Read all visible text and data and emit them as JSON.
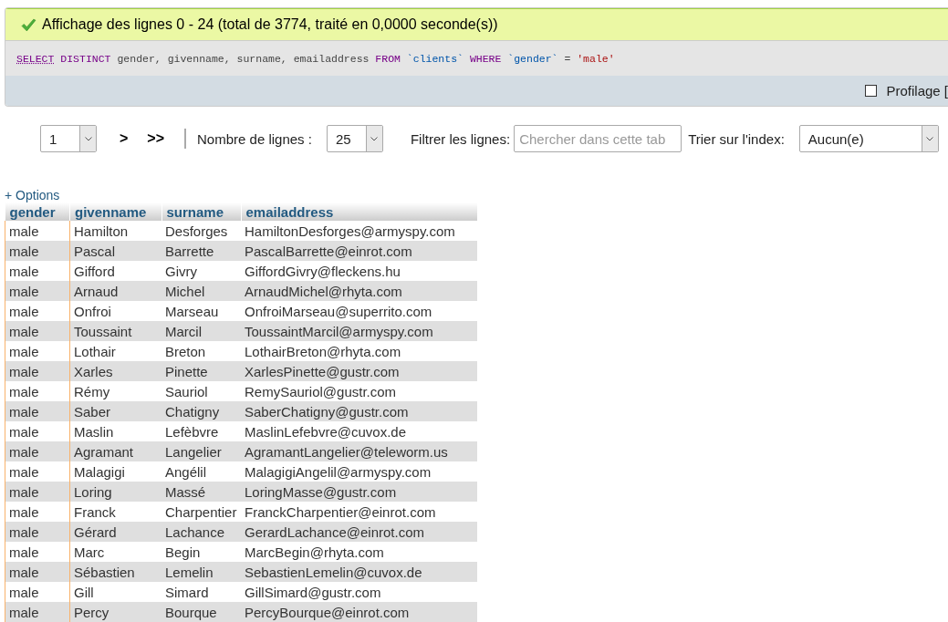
{
  "message": {
    "kind": "success",
    "text": "Affichage des lignes 0 - 24 (total de 3774, traité en 0,0000 seconde(s))"
  },
  "query": [
    {
      "kind": "keyword_link",
      "text": "SELECT"
    },
    {
      "kind": "keyword",
      "text": "DISTINCT"
    },
    {
      "kind": "plain",
      "text": "gender, givenname, surname, emailaddress"
    },
    {
      "kind": "keyword",
      "text": "FROM"
    },
    {
      "kind": "identifier",
      "text": "`clients`"
    },
    {
      "kind": "keyword",
      "text": "WHERE"
    },
    {
      "kind": "identifier",
      "text": "`gender`"
    },
    {
      "kind": "plain",
      "text": "="
    },
    {
      "kind": "string",
      "text": "'male'"
    }
  ],
  "profiling": {
    "label": "Profilage [",
    "checked": false
  },
  "navigation": {
    "page": "1",
    "next": ">",
    "last": ">>",
    "rows_label": "Nombre de lignes :",
    "rows_value": "25",
    "filter_label": "Filtrer les lignes:",
    "filter_placeholder": "Chercher dans cette tab",
    "sort_label": "Trier sur l'index:",
    "sort_value": "Aucun(e)"
  },
  "options_link": "+ Options",
  "table": {
    "columns": [
      "gender",
      "givenname",
      "surname",
      "emailaddress"
    ],
    "rows": [
      [
        "male",
        "Hamilton",
        "Desforges",
        "HamiltonDesforges@armyspy.com"
      ],
      [
        "male",
        "Pascal",
        "Barrette",
        "PascalBarrette@einrot.com"
      ],
      [
        "male",
        "Gifford",
        "Givry",
        "GiffordGivry@fleckens.hu"
      ],
      [
        "male",
        "Arnaud",
        "Michel",
        "ArnaudMichel@rhyta.com"
      ],
      [
        "male",
        "Onfroi",
        "Marseau",
        "OnfroiMarseau@superrito.com"
      ],
      [
        "male",
        "Toussaint",
        "Marcil",
        "ToussaintMarcil@armyspy.com"
      ],
      [
        "male",
        "Lothair",
        "Breton",
        "LothairBreton@rhyta.com"
      ],
      [
        "male",
        "Xarles",
        "Pinette",
        "XarlesPinette@gustr.com"
      ],
      [
        "male",
        "Rémy",
        "Sauriol",
        "RemySauriol@gustr.com"
      ],
      [
        "male",
        "Saber",
        "Chatigny",
        "SaberChatigny@gustr.com"
      ],
      [
        "male",
        "Maslin",
        "Lefèbvre",
        "MaslinLefebvre@cuvox.de"
      ],
      [
        "male",
        "Agramant",
        "Langelier",
        "AgramantLangelier@teleworm.us"
      ],
      [
        "male",
        "Malagigi",
        "Angélil",
        "MalagigiAngelil@armyspy.com"
      ],
      [
        "male",
        "Loring",
        "Massé",
        "LoringMasse@gustr.com"
      ],
      [
        "male",
        "Franck",
        "Charpentier",
        "FranckCharpentier@einrot.com"
      ],
      [
        "male",
        "Gérard",
        "Lachance",
        "GerardLachance@einrot.com"
      ],
      [
        "male",
        "Marc",
        "Begin",
        "MarcBegin@rhyta.com"
      ],
      [
        "male",
        "Sébastien",
        "Lemelin",
        "SebastienLemelin@cuvox.de"
      ],
      [
        "male",
        "Gill",
        "Simard",
        "GillSimard@gustr.com"
      ],
      [
        "male",
        "Percy",
        "Bourque",
        "PercyBourque@einrot.com"
      ]
    ]
  }
}
